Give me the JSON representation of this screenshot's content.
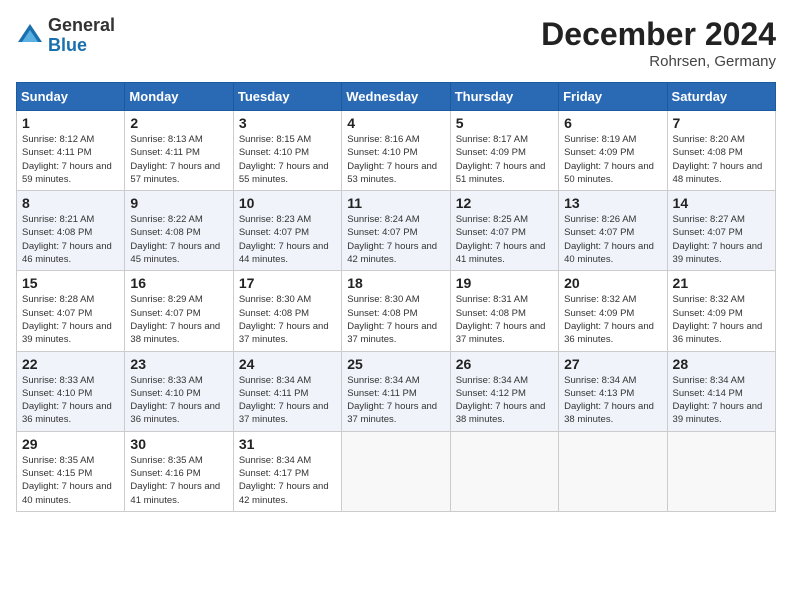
{
  "header": {
    "logo_line1": "General",
    "logo_line2": "Blue",
    "month_title": "December 2024",
    "location": "Rohrsen, Germany"
  },
  "days_of_week": [
    "Sunday",
    "Monday",
    "Tuesday",
    "Wednesday",
    "Thursday",
    "Friday",
    "Saturday"
  ],
  "weeks": [
    [
      {
        "day": "1",
        "sunrise": "Sunrise: 8:12 AM",
        "sunset": "Sunset: 4:11 PM",
        "daylight": "Daylight: 7 hours and 59 minutes."
      },
      {
        "day": "2",
        "sunrise": "Sunrise: 8:13 AM",
        "sunset": "Sunset: 4:11 PM",
        "daylight": "Daylight: 7 hours and 57 minutes."
      },
      {
        "day": "3",
        "sunrise": "Sunrise: 8:15 AM",
        "sunset": "Sunset: 4:10 PM",
        "daylight": "Daylight: 7 hours and 55 minutes."
      },
      {
        "day": "4",
        "sunrise": "Sunrise: 8:16 AM",
        "sunset": "Sunset: 4:10 PM",
        "daylight": "Daylight: 7 hours and 53 minutes."
      },
      {
        "day": "5",
        "sunrise": "Sunrise: 8:17 AM",
        "sunset": "Sunset: 4:09 PM",
        "daylight": "Daylight: 7 hours and 51 minutes."
      },
      {
        "day": "6",
        "sunrise": "Sunrise: 8:19 AM",
        "sunset": "Sunset: 4:09 PM",
        "daylight": "Daylight: 7 hours and 50 minutes."
      },
      {
        "day": "7",
        "sunrise": "Sunrise: 8:20 AM",
        "sunset": "Sunset: 4:08 PM",
        "daylight": "Daylight: 7 hours and 48 minutes."
      }
    ],
    [
      {
        "day": "8",
        "sunrise": "Sunrise: 8:21 AM",
        "sunset": "Sunset: 4:08 PM",
        "daylight": "Daylight: 7 hours and 46 minutes."
      },
      {
        "day": "9",
        "sunrise": "Sunrise: 8:22 AM",
        "sunset": "Sunset: 4:08 PM",
        "daylight": "Daylight: 7 hours and 45 minutes."
      },
      {
        "day": "10",
        "sunrise": "Sunrise: 8:23 AM",
        "sunset": "Sunset: 4:07 PM",
        "daylight": "Daylight: 7 hours and 44 minutes."
      },
      {
        "day": "11",
        "sunrise": "Sunrise: 8:24 AM",
        "sunset": "Sunset: 4:07 PM",
        "daylight": "Daylight: 7 hours and 42 minutes."
      },
      {
        "day": "12",
        "sunrise": "Sunrise: 8:25 AM",
        "sunset": "Sunset: 4:07 PM",
        "daylight": "Daylight: 7 hours and 41 minutes."
      },
      {
        "day": "13",
        "sunrise": "Sunrise: 8:26 AM",
        "sunset": "Sunset: 4:07 PM",
        "daylight": "Daylight: 7 hours and 40 minutes."
      },
      {
        "day": "14",
        "sunrise": "Sunrise: 8:27 AM",
        "sunset": "Sunset: 4:07 PM",
        "daylight": "Daylight: 7 hours and 39 minutes."
      }
    ],
    [
      {
        "day": "15",
        "sunrise": "Sunrise: 8:28 AM",
        "sunset": "Sunset: 4:07 PM",
        "daylight": "Daylight: 7 hours and 39 minutes."
      },
      {
        "day": "16",
        "sunrise": "Sunrise: 8:29 AM",
        "sunset": "Sunset: 4:07 PM",
        "daylight": "Daylight: 7 hours and 38 minutes."
      },
      {
        "day": "17",
        "sunrise": "Sunrise: 8:30 AM",
        "sunset": "Sunset: 4:08 PM",
        "daylight": "Daylight: 7 hours and 37 minutes."
      },
      {
        "day": "18",
        "sunrise": "Sunrise: 8:30 AM",
        "sunset": "Sunset: 4:08 PM",
        "daylight": "Daylight: 7 hours and 37 minutes."
      },
      {
        "day": "19",
        "sunrise": "Sunrise: 8:31 AM",
        "sunset": "Sunset: 4:08 PM",
        "daylight": "Daylight: 7 hours and 37 minutes."
      },
      {
        "day": "20",
        "sunrise": "Sunrise: 8:32 AM",
        "sunset": "Sunset: 4:09 PM",
        "daylight": "Daylight: 7 hours and 36 minutes."
      },
      {
        "day": "21",
        "sunrise": "Sunrise: 8:32 AM",
        "sunset": "Sunset: 4:09 PM",
        "daylight": "Daylight: 7 hours and 36 minutes."
      }
    ],
    [
      {
        "day": "22",
        "sunrise": "Sunrise: 8:33 AM",
        "sunset": "Sunset: 4:10 PM",
        "daylight": "Daylight: 7 hours and 36 minutes."
      },
      {
        "day": "23",
        "sunrise": "Sunrise: 8:33 AM",
        "sunset": "Sunset: 4:10 PM",
        "daylight": "Daylight: 7 hours and 36 minutes."
      },
      {
        "day": "24",
        "sunrise": "Sunrise: 8:34 AM",
        "sunset": "Sunset: 4:11 PM",
        "daylight": "Daylight: 7 hours and 37 minutes."
      },
      {
        "day": "25",
        "sunrise": "Sunrise: 8:34 AM",
        "sunset": "Sunset: 4:11 PM",
        "daylight": "Daylight: 7 hours and 37 minutes."
      },
      {
        "day": "26",
        "sunrise": "Sunrise: 8:34 AM",
        "sunset": "Sunset: 4:12 PM",
        "daylight": "Daylight: 7 hours and 38 minutes."
      },
      {
        "day": "27",
        "sunrise": "Sunrise: 8:34 AM",
        "sunset": "Sunset: 4:13 PM",
        "daylight": "Daylight: 7 hours and 38 minutes."
      },
      {
        "day": "28",
        "sunrise": "Sunrise: 8:34 AM",
        "sunset": "Sunset: 4:14 PM",
        "daylight": "Daylight: 7 hours and 39 minutes."
      }
    ],
    [
      {
        "day": "29",
        "sunrise": "Sunrise: 8:35 AM",
        "sunset": "Sunset: 4:15 PM",
        "daylight": "Daylight: 7 hours and 40 minutes."
      },
      {
        "day": "30",
        "sunrise": "Sunrise: 8:35 AM",
        "sunset": "Sunset: 4:16 PM",
        "daylight": "Daylight: 7 hours and 41 minutes."
      },
      {
        "day": "31",
        "sunrise": "Sunrise: 8:34 AM",
        "sunset": "Sunset: 4:17 PM",
        "daylight": "Daylight: 7 hours and 42 minutes."
      },
      null,
      null,
      null,
      null
    ]
  ]
}
